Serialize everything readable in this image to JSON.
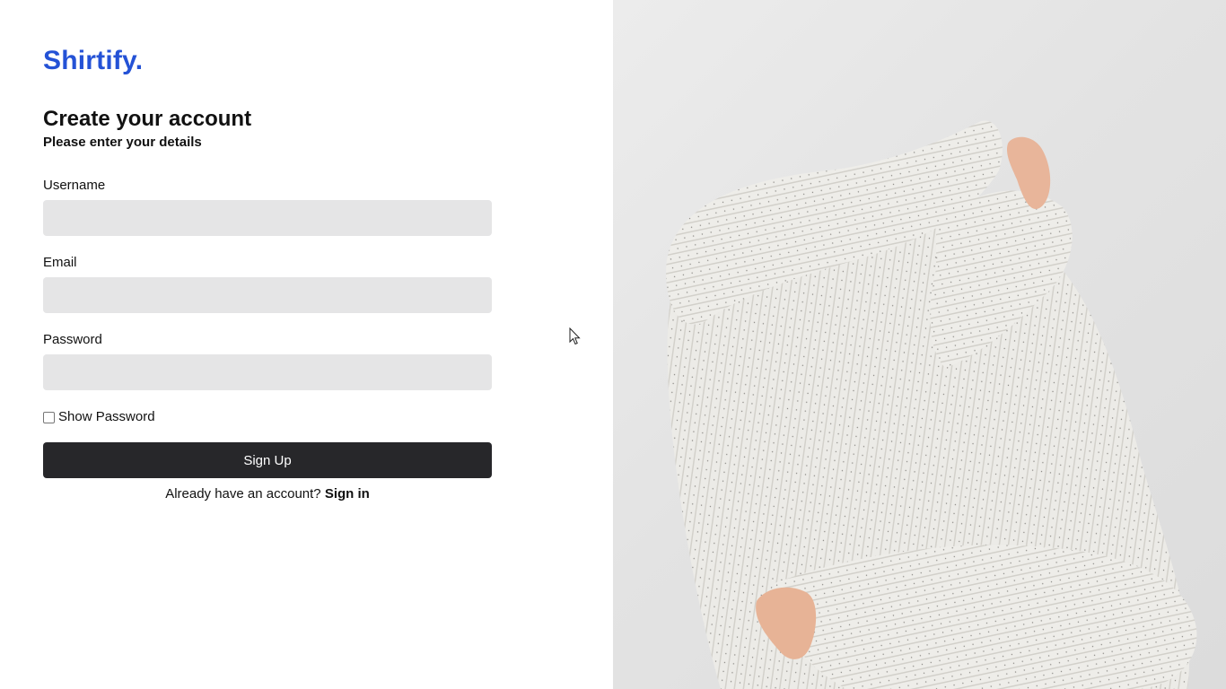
{
  "brand": {
    "name": "Shirtify."
  },
  "form": {
    "title": "Create your account",
    "subtitle": "Please enter your details",
    "fields": [
      {
        "label": "Username",
        "value": "",
        "type": "text"
      },
      {
        "label": "Email",
        "value": "",
        "type": "email"
      },
      {
        "label": "Password",
        "value": "",
        "type": "password"
      }
    ],
    "show_password_label": "Show Password",
    "show_password_checked": false,
    "submit_label": "Sign Up",
    "footer_text": "Already have an account? ",
    "footer_link": "Sign in"
  },
  "colors": {
    "brand": "#2452d6",
    "button": "#27272a",
    "input_bg": "#e5e5e6"
  },
  "hero_image": {
    "subject": "person pulling off a knit sweater",
    "icon": "photo"
  }
}
